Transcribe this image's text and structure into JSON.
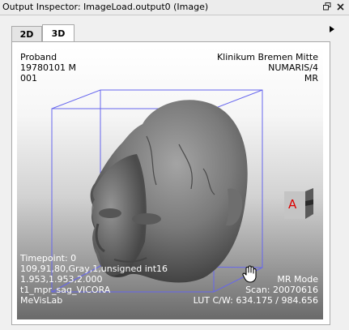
{
  "window": {
    "title": "Output Inspector: ImageLoad.output0 (Image)",
    "float_icon": "float-window-icon",
    "close_icon": "close-icon"
  },
  "tabs": [
    {
      "label": "2D",
      "active": false
    },
    {
      "label": "3D",
      "active": true
    }
  ],
  "tab_scroll_icon": "arrow-right-icon",
  "overlay": {
    "top_left": [
      "Proband",
      "19780101  M",
      "001"
    ],
    "top_right": [
      "Klinikum Bremen Mitte",
      "NUMARIS/4",
      "MR"
    ],
    "bottom_left": [
      "Timepoint: 0",
      "109,91,80,Gray,1,unsigned int16",
      "1.953,1.953,2.000",
      "t1_mpr_sag_VICORA",
      "MeVisLab"
    ],
    "bottom_right": [
      "MR Mode",
      "Scan: 20070616",
      "LUT C/W: 634.175 / 984.656"
    ]
  },
  "orientation_cube": {
    "label": "A",
    "icon": "orientation-cube-icon"
  },
  "cursor": {
    "icon": "hand-cursor-icon"
  },
  "colors": {
    "bounding_box": "#6666ee",
    "cube_label": "#dd0000"
  }
}
